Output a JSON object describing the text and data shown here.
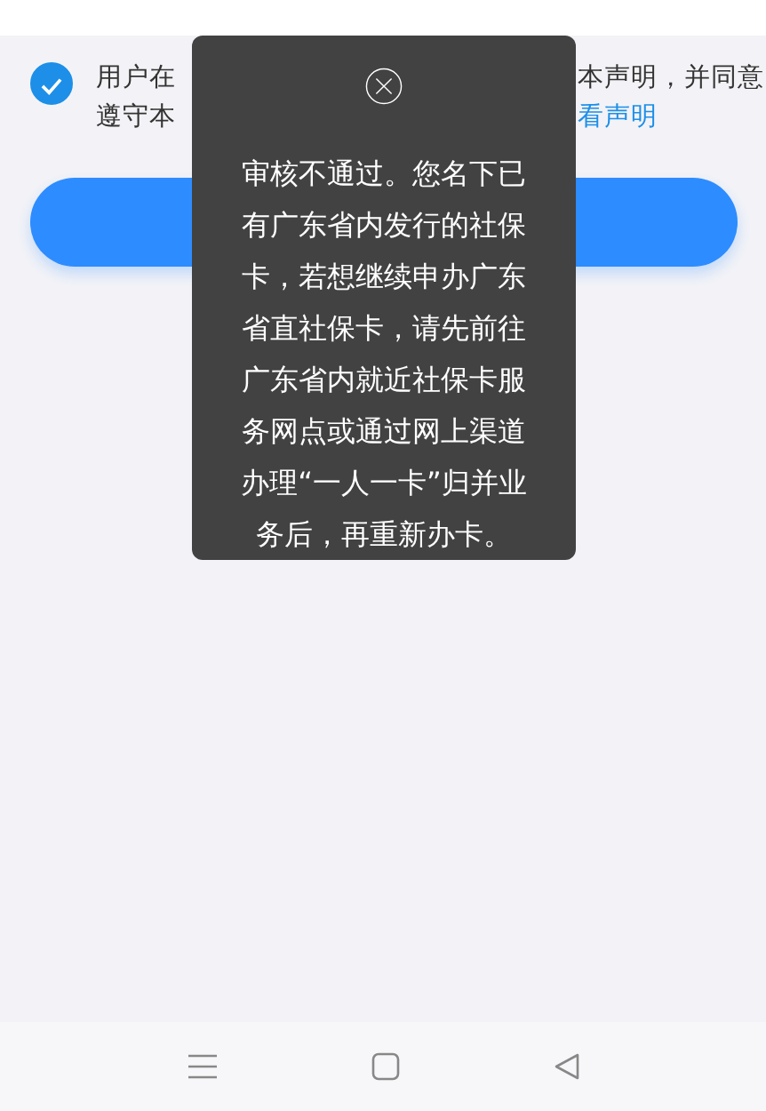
{
  "agreement": {
    "checked": true,
    "left_lines": [
      "用户在",
      "遵守本"
    ],
    "right_text": "本声明，并同意",
    "link": "看声明"
  },
  "toast": {
    "message": "审核不通过。您名下已有广东省内发行的社保卡，若想继续申办广东省直社保卡，请先前往广东省内就近社保卡服务网点或通过网上渠道办理“一人一卡”归并业务后，再重新办卡。"
  },
  "nav_bar": {
    "buttons": [
      {
        "kind": "menu"
      },
      {
        "kind": "home"
      },
      {
        "kind": "back"
      }
    ]
  }
}
